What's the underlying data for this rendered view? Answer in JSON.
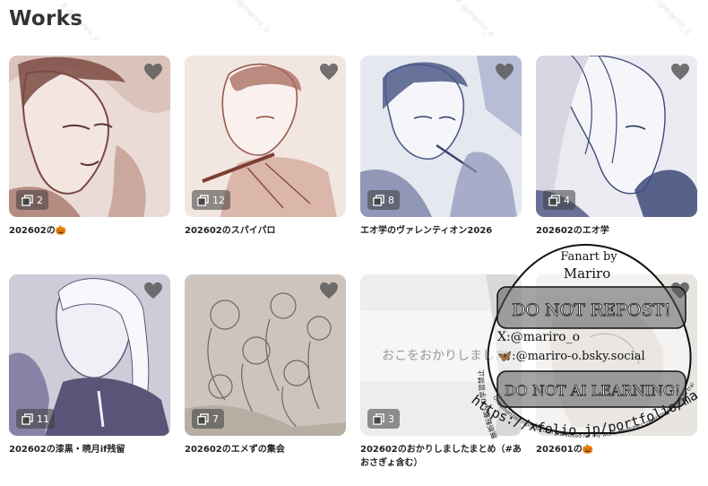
{
  "page": {
    "title": "Works"
  },
  "background_watermark": "X:@mariro_o",
  "works": [
    {
      "caption": "202602の🎃",
      "count": "2",
      "tone": "#8a5e56",
      "bg": "#eadbd6"
    },
    {
      "caption": "202602のスパイパロ",
      "count": "12",
      "tone": "#9a5a4a",
      "bg": "#f2e6e1"
    },
    {
      "caption": "エオ学のヴァレンティオン2026",
      "count": "8",
      "tone": "#4d5a88",
      "bg": "#e6e8f0"
    },
    {
      "caption": "202602のエオ学",
      "count": "4",
      "tone": "#3d4a78",
      "bg": "#ebeaf0"
    },
    {
      "caption": "202602の漆黒・暁月if残留",
      "count": "11",
      "tone": "#5c5478",
      "bg": "#cfcbd8"
    },
    {
      "caption": "202602のエメずの集会",
      "count": "7",
      "tone": "#6f6660",
      "bg": "#cdc5bd"
    },
    {
      "caption": "202602のおかりしましたまとめ（#あおさぎょ含む）",
      "count": "3",
      "tone": "#a7a7a7",
      "bg": "#ededed",
      "overlay_text": "おこをおかりしました"
    },
    {
      "caption": "202601の🎃",
      "count": "",
      "tone": "#888",
      "bg": "#e8e4e0"
    }
  ],
  "stamp": {
    "title_line1": "Fanart by",
    "title_line2": "Mariro",
    "notice1": "DO NOT REPOST!",
    "handle_x": "X:@mariro_o",
    "handle_bsky": "🦋:@mariro-o.bsky.social",
    "notice2": "DO NOT AI LEARNING!",
    "ring_left": "無断転載&AI学習禁止",
    "ring_bottom": "Unauthorized reproduction prohibited for my work. *Prohibits using my content to train AI models.",
    "url": "https://xfolio.jp/portfolio/mariro_o"
  },
  "colors": {
    "heart": "#ffffff",
    "badge_bg": "#3c3c3c"
  }
}
